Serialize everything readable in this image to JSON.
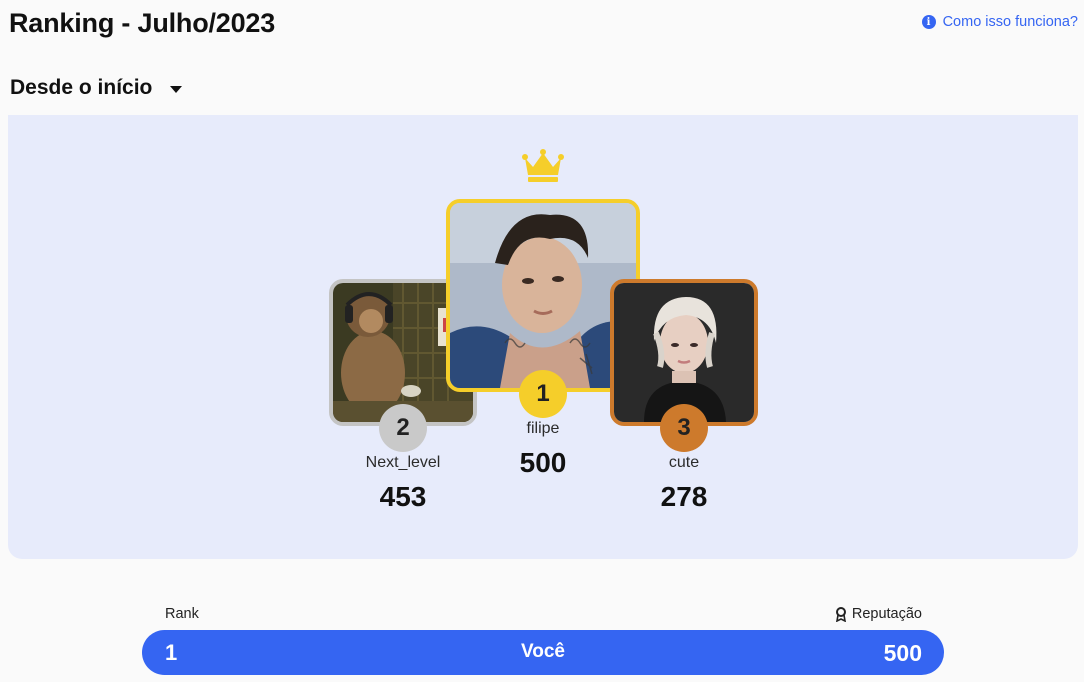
{
  "header": {
    "title": "Ranking - Julho/2023",
    "help_link": "Como isso funciona?"
  },
  "period_select": {
    "selected": "Desde o início"
  },
  "podium": [
    {
      "rank": "2",
      "username": "Next_level",
      "score": "453"
    },
    {
      "rank": "1",
      "username": "filipe",
      "score": "500"
    },
    {
      "rank": "3",
      "username": "cute",
      "score": "278"
    }
  ],
  "table_header": {
    "rank": "Rank",
    "reputation": "Reputação"
  },
  "current_user": {
    "rank": "1",
    "label": "Você",
    "score": "500"
  },
  "colors": {
    "accent": "#3565f2",
    "gold": "#f5ce2a",
    "silver": "#c9c9c9",
    "bronze": "#cd7a2c",
    "panel": "#e7ebfb"
  }
}
